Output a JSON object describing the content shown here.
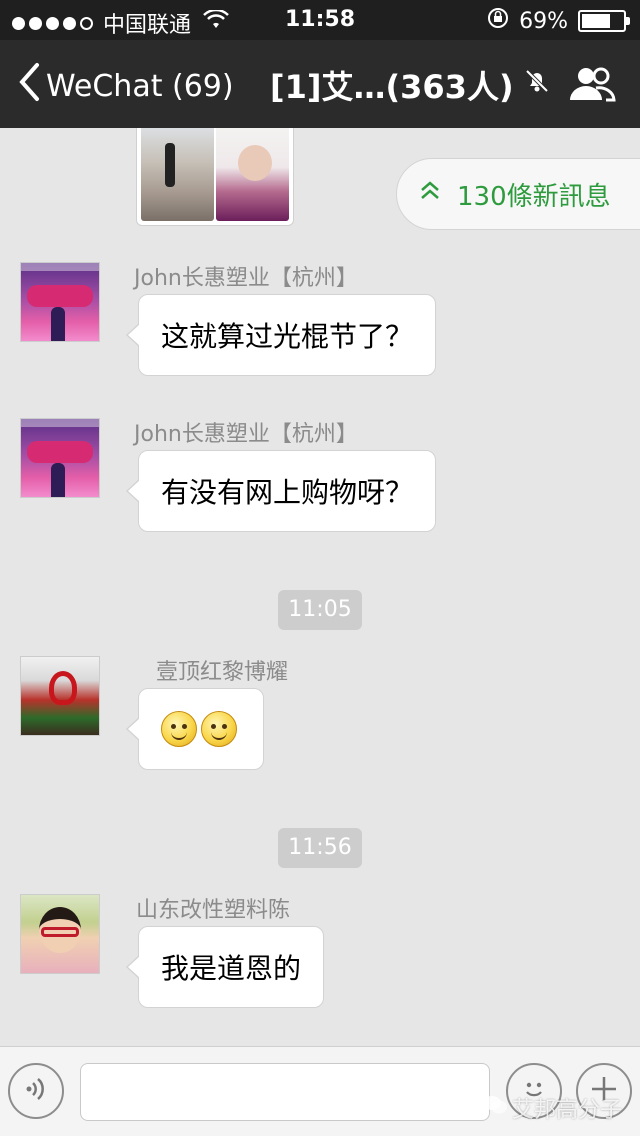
{
  "status_bar": {
    "carrier": "中国联通",
    "time": "11:58",
    "battery_percent": "69%",
    "battery_level": 0.69,
    "signal_bars": 4
  },
  "nav": {
    "back_label": "WeChat (69)",
    "title": "[1]艾…(363人)"
  },
  "new_messages": {
    "label": "130條新訊息"
  },
  "messages": [
    {
      "sender": "John长惠塑业【杭州】",
      "text": "这就算过光棍节了？"
    },
    {
      "sender": "John长惠塑业【杭州】",
      "text": "有没有网上购物呀？"
    },
    {
      "sender": "壹顶红黎博耀",
      "text": ""
    },
    {
      "sender": "山东改性塑料陈",
      "text": "我是道恩的"
    }
  ],
  "timestamps": [
    "11:05",
    "11:56"
  ],
  "watermark": "艾邦高分子",
  "icons": {
    "back": "chevron-left-icon",
    "mute": "bell-muted-icon",
    "members": "group-members-icon",
    "voice": "voice-icon",
    "emoji": "emoji-icon",
    "more": "plus-icon",
    "new_messages": "double-chevron-up-icon"
  },
  "colors": {
    "nav_bg": "#2b2b2b",
    "chat_bg": "#e6e6e6",
    "new_message_accent": "#2e9b3e",
    "timestamp_pill": "#cdcdcd"
  }
}
